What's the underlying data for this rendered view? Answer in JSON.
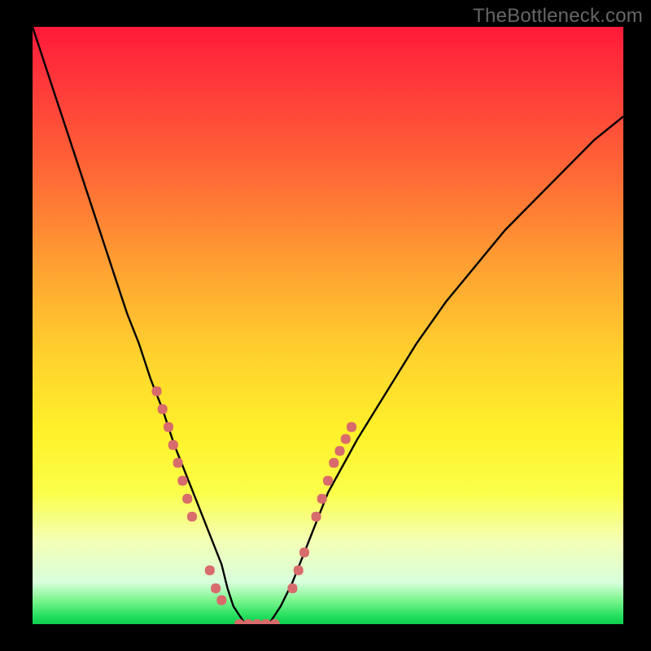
{
  "watermark": "TheBottleneck.com",
  "colors": {
    "background": "#000000",
    "watermark": "#666666",
    "curve_stroke": "#000000",
    "marker_fill": "#d86b6b",
    "gradient_stops": [
      "#ff1a3a",
      "#ff3a3a",
      "#ff6a36",
      "#ffa032",
      "#ffd22e",
      "#fff12a",
      "#fbff4a",
      "#f4ffb4",
      "#d8ffdc",
      "#7cf58e",
      "#29e060",
      "#0bce4d"
    ]
  },
  "chart_data": {
    "type": "line",
    "title": "",
    "xlabel": "",
    "ylabel": "",
    "xlim": [
      0,
      100
    ],
    "ylim": [
      0,
      100
    ],
    "grid": false,
    "legend": false,
    "annotations": [
      "TheBottleneck.com"
    ],
    "series": [
      {
        "name": "bottleneck-curve",
        "x": [
          0,
          2,
          4,
          6,
          8,
          10,
          12,
          14,
          16,
          18,
          20,
          22,
          24,
          26,
          28,
          30,
          32,
          33,
          34,
          36,
          38,
          40,
          42,
          44,
          46,
          48,
          50,
          55,
          60,
          65,
          70,
          75,
          80,
          85,
          90,
          95,
          100
        ],
        "y": [
          100,
          94,
          88,
          82,
          76,
          70,
          64,
          58,
          52,
          47,
          41,
          36,
          30,
          25,
          20,
          15,
          10,
          6,
          3,
          0,
          0,
          0,
          3,
          7,
          12,
          17,
          22,
          31,
          39,
          47,
          54,
          60,
          66,
          71,
          76,
          81,
          85
        ]
      }
    ],
    "markers": {
      "name": "highlight-dots",
      "points_xy": [
        [
          21,
          39
        ],
        [
          22,
          36
        ],
        [
          23,
          33
        ],
        [
          23.8,
          30
        ],
        [
          24.6,
          27
        ],
        [
          25.4,
          24
        ],
        [
          26.2,
          21
        ],
        [
          27,
          18
        ],
        [
          30,
          9
        ],
        [
          31,
          6
        ],
        [
          32,
          4
        ],
        [
          35,
          0
        ],
        [
          36.5,
          0
        ],
        [
          38,
          0
        ],
        [
          39.5,
          0
        ],
        [
          41,
          0
        ],
        [
          44,
          6
        ],
        [
          45,
          9
        ],
        [
          46,
          12
        ],
        [
          48,
          18
        ],
        [
          49,
          21
        ],
        [
          50,
          24
        ],
        [
          51,
          27
        ],
        [
          52,
          29
        ],
        [
          53,
          31
        ],
        [
          54,
          33
        ]
      ]
    },
    "note": "Values are estimates read off an unlabeled gradient chart (no axes, ticks, or legend). x is horizontal position (0–100), y is vertical position with 0 at the bottom green band and 100 at the top red band. The curve is a V shape with minimum near x≈36–41."
  }
}
